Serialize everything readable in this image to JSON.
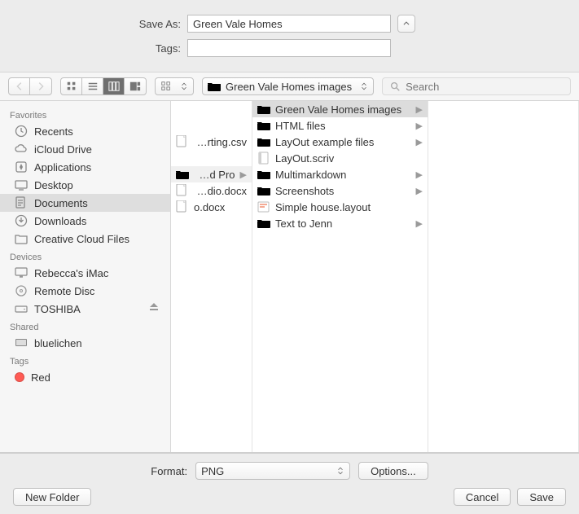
{
  "topFields": {
    "saveAsLabel": "Save As:",
    "saveAsValue": "Green Vale Homes",
    "tagsLabel": "Tags:",
    "tagsValue": ""
  },
  "toolbar": {
    "pathPopup": "Green Vale Homes images",
    "searchPlaceholder": "Search"
  },
  "sidebar": {
    "sections": [
      {
        "heading": "Favorites",
        "items": [
          {
            "name": "recents",
            "label": "Recents",
            "icon": "clock"
          },
          {
            "name": "icloud",
            "label": "iCloud Drive",
            "icon": "cloud"
          },
          {
            "name": "applications",
            "label": "Applications",
            "icon": "app"
          },
          {
            "name": "desktop",
            "label": "Desktop",
            "icon": "desktop"
          },
          {
            "name": "documents",
            "label": "Documents",
            "icon": "doc",
            "selected": true
          },
          {
            "name": "downloads",
            "label": "Downloads",
            "icon": "download"
          },
          {
            "name": "ccfiles",
            "label": "Creative Cloud Files",
            "icon": "folder"
          }
        ]
      },
      {
        "heading": "Devices",
        "items": [
          {
            "name": "imac",
            "label": "Rebecca's iMac",
            "icon": "imac"
          },
          {
            "name": "remotedisc",
            "label": "Remote Disc",
            "icon": "disc"
          },
          {
            "name": "toshiba",
            "label": "TOSHIBA",
            "icon": "drive",
            "eject": true
          }
        ]
      },
      {
        "heading": "Shared",
        "items": [
          {
            "name": "bluelichen",
            "label": "bluelichen",
            "icon": "screen"
          }
        ]
      },
      {
        "heading": "Tags",
        "items": [
          {
            "name": "tag-red",
            "label": "Red",
            "icon": "tag",
            "color": "#ff5b54"
          }
        ]
      }
    ]
  },
  "columns": {
    "col1": [
      {
        "label": "",
        "icon": "none"
      },
      {
        "label": "",
        "icon": "none"
      },
      {
        "label": "xporting.csv",
        "icon": "doc"
      },
      {
        "label": "",
        "icon": "none"
      },
      {
        "label": "e and Pro",
        "icon": "folder",
        "hasChildren": true,
        "childSelected": true
      },
      {
        "label": "Studio.docx",
        "icon": "doc"
      },
      {
        "label": "o.docx",
        "icon": "doc"
      }
    ],
    "col2": [
      {
        "label": "Green Vale Homes images",
        "icon": "folder",
        "hasChildren": true,
        "selected": true
      },
      {
        "label": "HTML files",
        "icon": "folder",
        "hasChildren": true
      },
      {
        "label": "LayOut example files",
        "icon": "folder",
        "hasChildren": true
      },
      {
        "label": "LayOut.scriv",
        "icon": "scriv"
      },
      {
        "label": "Multimarkdown",
        "icon": "folder",
        "hasChildren": true
      },
      {
        "label": "Screenshots",
        "icon": "folder",
        "hasChildren": true
      },
      {
        "label": "Simple house.layout",
        "icon": "layout"
      },
      {
        "label": "Text to Jenn",
        "icon": "folder",
        "hasChildren": true
      }
    ]
  },
  "bottom": {
    "formatLabel": "Format:",
    "formatValue": "PNG",
    "optionsLabel": "Options...",
    "newFolderLabel": "New Folder",
    "cancelLabel": "Cancel",
    "saveLabel": "Save"
  }
}
